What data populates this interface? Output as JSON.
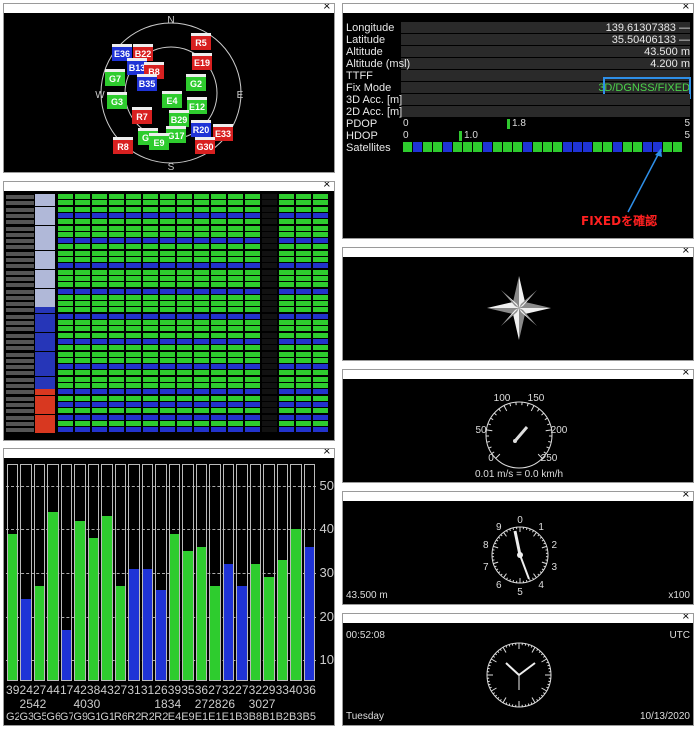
{
  "close_glyph": "×",
  "skyplot": {
    "directions": {
      "n": "N",
      "e": "E",
      "s": "S",
      "w": "W"
    },
    "sats": [
      {
        "id": "R5",
        "c": "red"
      },
      {
        "id": "E19",
        "c": "red"
      },
      {
        "id": "E36",
        "c": "blue"
      },
      {
        "id": "B22",
        "c": "red"
      },
      {
        "id": "B13",
        "c": "blue"
      },
      {
        "id": "B8",
        "c": "red"
      },
      {
        "id": "G7",
        "c": "green"
      },
      {
        "id": "B35",
        "c": "blue"
      },
      {
        "id": "G3",
        "c": "green"
      },
      {
        "id": "G2",
        "c": "green"
      },
      {
        "id": "E4",
        "c": "green"
      },
      {
        "id": "E12",
        "c": "green"
      },
      {
        "id": "R7",
        "c": "red"
      },
      {
        "id": "B29",
        "c": "green"
      },
      {
        "id": "G9",
        "c": "green"
      },
      {
        "id": "G17",
        "c": "green"
      },
      {
        "id": "R20",
        "c": "blue"
      },
      {
        "id": "E33",
        "c": "red"
      },
      {
        "id": "R8",
        "c": "red"
      },
      {
        "id": "G30",
        "c": "red"
      },
      {
        "id": "E9",
        "c": "green"
      }
    ]
  },
  "status": {
    "rows": [
      {
        "label": "Longitude",
        "value": "139.61307383 —"
      },
      {
        "label": "Latitude",
        "value": "35.50406133 —"
      },
      {
        "label": "Altitude",
        "value": "43.500 m"
      },
      {
        "label": "Altitude (msl)",
        "value": "4.200 m"
      },
      {
        "label": "TTFF",
        "value": ""
      },
      {
        "label": "Fix Mode",
        "value": "3D/DGNSS/FIXED"
      },
      {
        "label": "3D Acc. [m]",
        "value": ""
      },
      {
        "label": "2D Acc. [m]",
        "value": ""
      }
    ],
    "pdop": {
      "label": "PDOP",
      "min": "0",
      "max": "5",
      "value": "1.8"
    },
    "hdop": {
      "label": "HDOP",
      "min": "0",
      "max": "5",
      "value": "1.0"
    },
    "satellites_label": "Satellites",
    "annotation": "FIXEDを確認"
  },
  "speed": {
    "ticks": [
      "50",
      "100",
      "150",
      "200",
      "250",
      "0"
    ],
    "readout": "0.01 m/s = 0.0 km/h"
  },
  "altimeter": {
    "ticks": [
      "0",
      "1",
      "2",
      "3",
      "4",
      "5",
      "6",
      "7",
      "8",
      "9"
    ],
    "altitude": "43.500 m",
    "scale": "x100"
  },
  "clock": {
    "time": "00:52:08",
    "zone": "UTC",
    "day": "Tuesday",
    "date": "10/13/2020"
  },
  "snr": {
    "y_ticks": [
      "50",
      "40",
      "30",
      "20",
      "10"
    ],
    "values": [
      "39",
      "24",
      "27",
      "44",
      "17",
      "42",
      "38",
      "43",
      "27",
      "31",
      "31",
      "26",
      "39",
      "35",
      "36",
      "27",
      "32",
      "27",
      "32",
      "29",
      "33",
      "40",
      "36"
    ],
    "values2": [
      "",
      "25",
      "42",
      "",
      "",
      "40",
      "30",
      "",
      "",
      "",
      "",
      "18",
      "34",
      "",
      "27",
      "28",
      "26",
      "",
      "30",
      "27",
      "",
      "",
      ""
    ],
    "names": [
      "G2",
      "G3",
      "G5",
      "G6",
      "G7",
      "G9",
      "G1",
      "G19",
      "R6",
      "R20",
      "R22",
      "R2",
      "E4",
      "E9",
      "E11",
      "E12",
      "E1",
      "B36",
      "B8",
      "B1",
      "B2",
      "B3",
      "B5"
    ],
    "colors": [
      "green",
      "blue",
      "green",
      "green",
      "blue",
      "green",
      "green",
      "green",
      "green",
      "blue",
      "blue",
      "blue",
      "green",
      "green",
      "green",
      "green",
      "blue",
      "blue",
      "green",
      "green",
      "green",
      "green",
      "blue"
    ]
  }
}
